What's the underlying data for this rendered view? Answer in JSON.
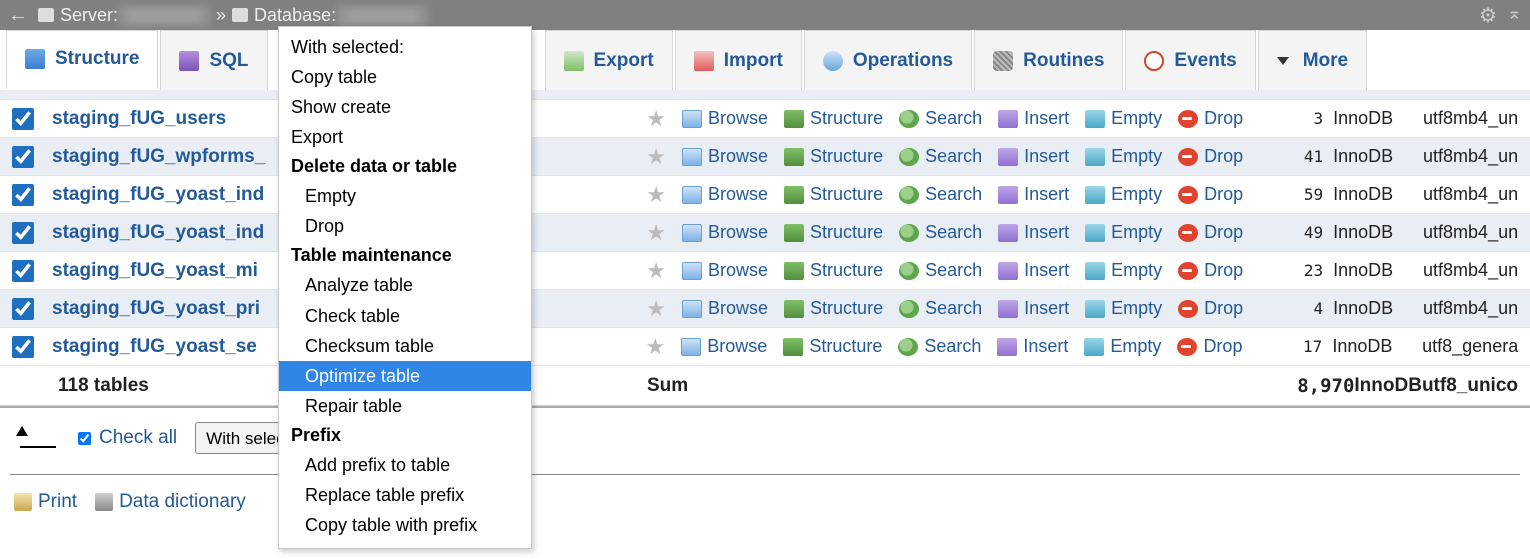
{
  "breadcrumb": {
    "server_label": "Server:",
    "database_label": "Database:"
  },
  "tabs": {
    "structure": "Structure",
    "sql": "SQL",
    "export": "Export",
    "import": "Import",
    "operations": "Operations",
    "routines": "Routines",
    "events": "Events",
    "more": "More"
  },
  "rows": [
    {
      "name": "staging_fUG_users",
      "count": "3",
      "engine": "InnoDB",
      "collation": "utf8mb4_un"
    },
    {
      "name": "staging_fUG_wpforms_",
      "count": "41",
      "engine": "InnoDB",
      "collation": "utf8mb4_un"
    },
    {
      "name": "staging_fUG_yoast_ind",
      "count": "59",
      "engine": "InnoDB",
      "collation": "utf8mb4_un"
    },
    {
      "name": "staging_fUG_yoast_ind",
      "count": "49",
      "engine": "InnoDB",
      "collation": "utf8mb4_un"
    },
    {
      "name": "staging_fUG_yoast_mi",
      "count": "23",
      "engine": "InnoDB",
      "collation": "utf8mb4_un"
    },
    {
      "name": "staging_fUG_yoast_pri",
      "count": "4",
      "engine": "InnoDB",
      "collation": "utf8mb4_un"
    },
    {
      "name": "staging_fUG_yoast_se",
      "count": "17",
      "engine": "InnoDB",
      "collation": "utf8_genera"
    }
  ],
  "actions": {
    "browse": "Browse",
    "structure": "Structure",
    "search": "Search",
    "insert": "Insert",
    "empty": "Empty",
    "drop": "Drop"
  },
  "sum": {
    "label_tables": "118 tables",
    "label_sum": "Sum",
    "count": "8,970",
    "engine": "InnoDB",
    "collation": "utf8_unico"
  },
  "footer": {
    "check_all": "Check all",
    "with_selected": "With selected:"
  },
  "bottom": {
    "print": "Print",
    "data_dictionary": "Data dictionary"
  },
  "context_menu": {
    "with_selected": "With selected:",
    "copy_table": "Copy table",
    "show_create": "Show create",
    "export": "Export",
    "delete_header": "Delete data or table",
    "empty": "Empty",
    "drop": "Drop",
    "maint_header": "Table maintenance",
    "analyze": "Analyze table",
    "check": "Check table",
    "checksum": "Checksum table",
    "optimize": "Optimize table",
    "repair": "Repair table",
    "prefix_header": "Prefix",
    "add_prefix": "Add prefix to table",
    "replace_prefix": "Replace table prefix",
    "copy_prefix": "Copy table with prefix"
  }
}
